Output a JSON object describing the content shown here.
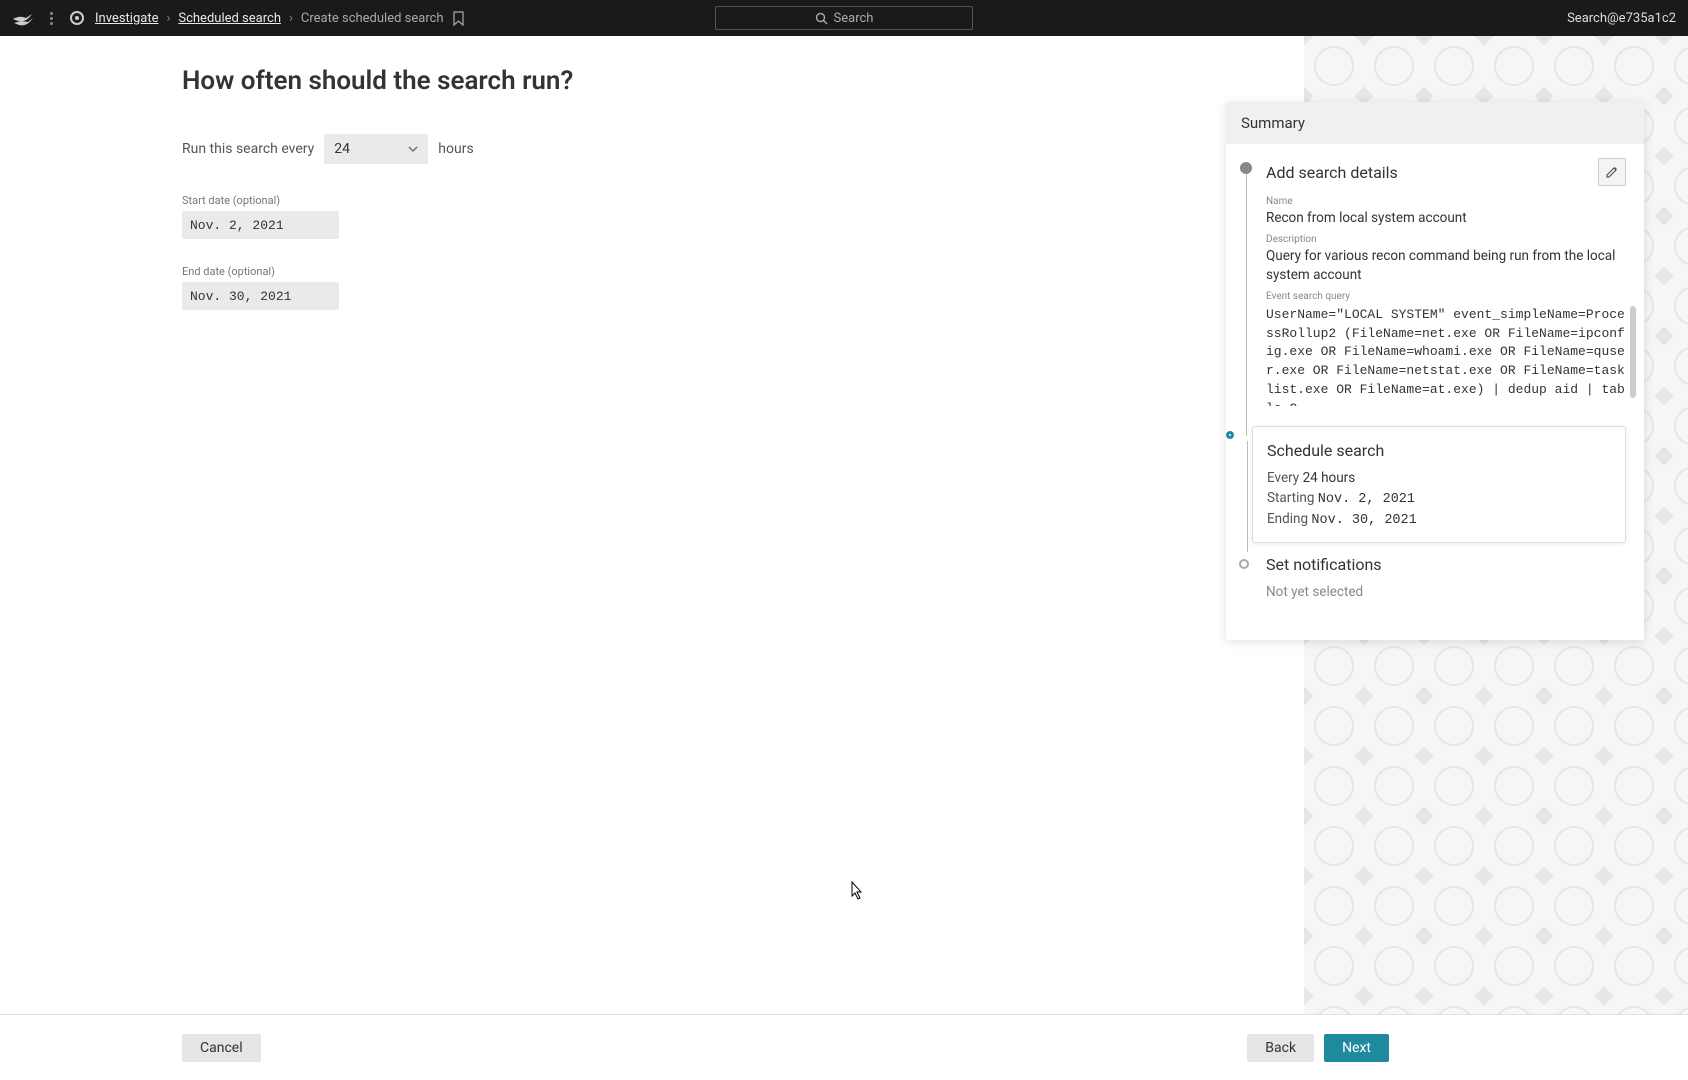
{
  "topbar": {
    "breadcrumb": {
      "l1": "Investigate",
      "l2": "Scheduled search",
      "l3": "Create scheduled search"
    },
    "search_placeholder": "Search",
    "account": "Search@e735a1c2"
  },
  "form": {
    "title": "How often should the search run?",
    "run_prefix": "Run this search every",
    "interval_value": "24",
    "interval_unit": "hours",
    "start_label": "Start date (optional)",
    "start_value": "Nov. 2, 2021",
    "end_label": "End date (optional)",
    "end_value": "Nov. 30, 2021"
  },
  "summary": {
    "header": "Summary",
    "step1": {
      "title": "Add search details",
      "name_label": "Name",
      "name_value": "Recon from local system account",
      "desc_label": "Description",
      "desc_value": "Query for various recon command being run from the local system account",
      "query_label": "Event search query",
      "query_value": "UserName=\"LOCAL SYSTEM\" event_simpleName=ProcessRollup2 (FileName=net.exe OR FileName=ipconfig.exe OR FileName=whoami.exe OR FileName=quser.exe OR FileName=netstat.exe OR FileName=tasklist.exe OR FileName=at.exe) | dedup aid | table C"
    },
    "step2": {
      "title": "Schedule search",
      "every_prefix": "Every",
      "every_value": "24 hours",
      "starting_prefix": "Starting",
      "starting_value": "Nov. 2, 2021",
      "ending_prefix": "Ending",
      "ending_value": "Nov. 30, 2021"
    },
    "step3": {
      "title": "Set notifications",
      "status": "Not yet selected"
    }
  },
  "footer": {
    "cancel": "Cancel",
    "back": "Back",
    "next": "Next"
  }
}
